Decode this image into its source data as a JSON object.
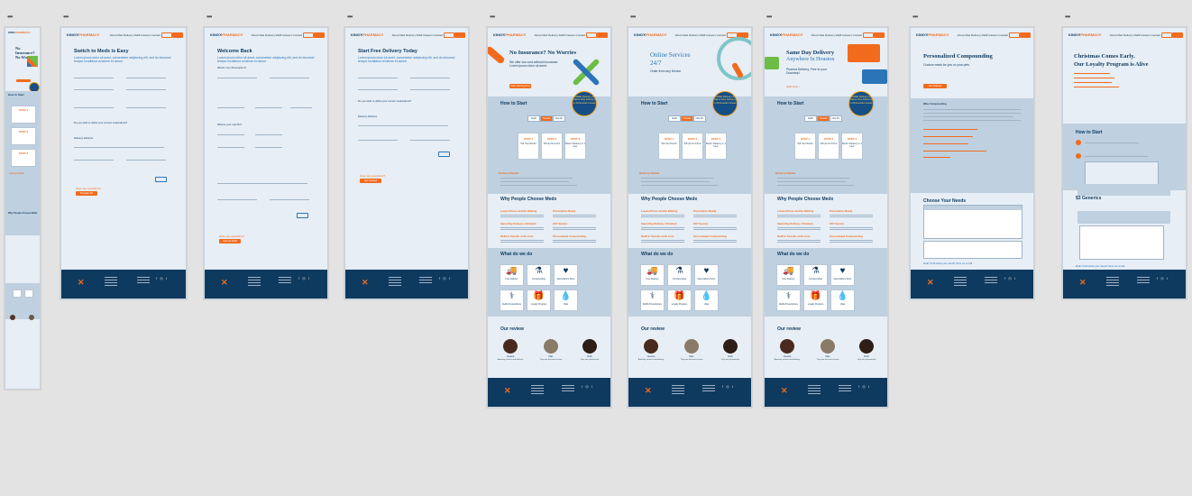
{
  "brand": {
    "name_a": "KING",
    "name_b": "PHARMACY",
    "accent": "#f26b1d",
    "navy": "#0f3a5f",
    "canvas_bg": "#e3e3e3"
  },
  "nav": {
    "links": "About   Med Delivery   Refill   Careers   Contact"
  },
  "mobile": {
    "title": "No Insurance? No Worries",
    "how": "How to Start",
    "delivery": "Delivery Details",
    "why": "Why People Choose Medx"
  },
  "frames": {
    "switch": {
      "title": "Switch to Medx is Easy",
      "sub": "Lorem ipsum dolor sit amet, consectetur adipiscing elit, sed do eiusmod tempor incididunt ut labore et dolore",
      "q1": "Do you wish to utilize your current medications?",
      "q2": "Delivery Address",
      "cta": "Have any questions?",
      "button": "Transfer Rx"
    },
    "welcome": {
      "title": "Welcome Back",
      "sub": "Lorem ipsum dolor sit amet, consectetur adipiscing elit, sed do eiusmod tempor incididunt ut labore et dolore",
      "q1": "What's Your Prescription?",
      "q2": "What is your new Rx?",
      "cta": "Have any questions?",
      "button": "Submit Refill"
    },
    "free": {
      "title": "Start Free Delivery Today",
      "sub": "Lorem ipsum dolor sit amet, consectetur adipiscing elit, sed do eiusmod tempor incididunt ut labore et dolore",
      "q1": "Do you wish to utilize your current medications?",
      "q2": "Delivery Address",
      "cta": "Have any questions?",
      "button": "Get Started"
    },
    "noins": {
      "title": "No Insurance? No Worries",
      "sub": "We offer low cost without insurance. Lorem ipsum dolor sit amet.",
      "button": "Start Saving Now",
      "badge": "FREE Delivery & Same Day Delivery in All Houston areas"
    },
    "online": {
      "title": "Online Services",
      "title2": "24/7",
      "sub": "Order from any Device",
      "badge": "FREE Delivery & Same Day Delivery in All Houston areas"
    },
    "same": {
      "title": "Same Day Delivery",
      "title2": "Anywhere In Houston",
      "sub": "Pharma Delivery, Free to your Doorstep!",
      "link": "Start Now",
      "badge": "FREE Delivery & Same Day Delivery in All Houston areas"
    },
    "comp": {
      "title": "Personalized Compounding",
      "sub": "Custom meds for you or your pets",
      "button": "Get Started",
      "sec2": "Why Compounding",
      "sec3": "Choose Your Needs",
      "link": "Didn't find what you need? Give us a call"
    },
    "xmas": {
      "title": "Christmas Comes Early.",
      "title2": "Our Loyalty Program is Alive",
      "sec2": "How to Start",
      "sec3": "$3 Generics",
      "link": "Didn't find what you need? Give us a call"
    }
  },
  "how": {
    "title": "How to Start",
    "tabs": [
      "Refill",
      "Transfer",
      "New Rx"
    ],
    "steps": [
      {
        "t": "STEP 1",
        "d": "Tell Your Doctor"
      },
      {
        "t": "STEP 2",
        "d": "Fill Up Our Form"
      },
      {
        "t": "STEP 3",
        "d": "Boom! Delivery in 1 hour"
      }
    ]
  },
  "delivery": {
    "title": "Delivery Details"
  },
  "why": {
    "title": "Why People Choose Medx",
    "features": [
      "Lowest Prices and No Bidding",
      "Prescription Ready",
      "Same-Day Delivery, Unlimited",
      "24/7 Service",
      "Refill & Transfer at No Cost",
      "Personalized Compounding"
    ]
  },
  "what": {
    "title": "What do we do",
    "items": [
      {
        "glyph": "🚚",
        "cap": "Free Delivery",
        "icon": "truck-icon"
      },
      {
        "glyph": "⚗",
        "cap": "Compounding",
        "icon": "mortar-icon"
      },
      {
        "glyph": "♥",
        "cap": "Vaccinations Store",
        "icon": "heart-pill-icon"
      },
      {
        "glyph": "⚕",
        "cap": "Refills Prescriptions",
        "icon": "pharmacy-icon"
      },
      {
        "glyph": "🎁",
        "cap": "Loyalty Program",
        "icon": "gift-icon"
      },
      {
        "glyph": "💧",
        "cap": "Vials",
        "icon": "drop-icon"
      }
    ]
  },
  "reviews": {
    "title": "Our review",
    "people": [
      {
        "name": "Jessica",
        "quote": "Amazing service and delivery"
      },
      {
        "name": "Max",
        "quote": "They are the best in town"
      },
      {
        "name": "Ruth",
        "quote": "Very nice pharmacist"
      }
    ]
  }
}
